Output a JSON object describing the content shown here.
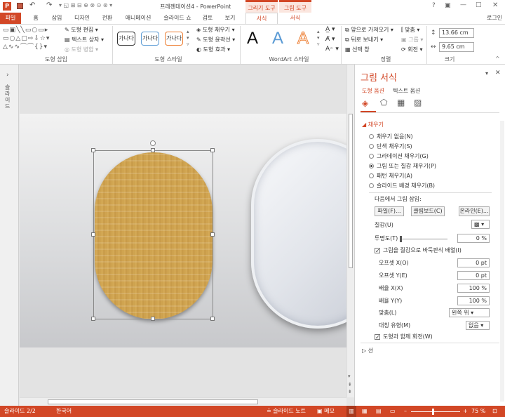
{
  "window": {
    "title": "프레젠테이션4 - PowerPoint",
    "contextual_drawing": "그리기 도구",
    "contextual_picture": "그림 도구",
    "signin": "로그인"
  },
  "tabs": [
    "파일",
    "홈",
    "삽입",
    "디자인",
    "전환",
    "애니메이션",
    "슬라이드 쇼",
    "검토",
    "보기",
    "서식",
    "서식"
  ],
  "ribbon": {
    "insert_shapes": {
      "label": "도형 삽입",
      "edit_shape": "도형 편집",
      "text_box": "텍스트 상자",
      "merge_shapes": "도형 병합"
    },
    "shape_styles": {
      "label": "도형 스타일",
      "sample": "가나다",
      "fill": "도형 채우기",
      "outline": "도형 윤곽선",
      "effects": "도형 효과"
    },
    "wordart": {
      "label": "WordArt 스타일",
      "sample": "A"
    },
    "arrange": {
      "label": "정렬",
      "bring_forward": "앞으로 가져오기",
      "send_backward": "뒤로 보내기",
      "selection_pane": "선택 창",
      "align": "맞춤",
      "group": "그룹",
      "rotate": "회전"
    },
    "size": {
      "label": "크기",
      "height": "13.66 cm",
      "width": "9.65 cm"
    }
  },
  "pane": {
    "title": "그림 서식",
    "tab_shape": "도형 옵션",
    "tab_text": "텍스트 옵션",
    "fill_section": "채우기",
    "fill_options": [
      "채우기 없음(N)",
      "단색 채우기(S)",
      "그라데이션 채우기(G)",
      "그림 또는 질감 채우기(P)",
      "패턴 채우기(A)",
      "슬라이드 배경 채우기(B)"
    ],
    "insert_from": "다음에서 그림 삽입:",
    "btn_file": "파일(F)...",
    "btn_clipboard": "클립보드(C)",
    "btn_online": "온라인(E)...",
    "texture": "질감(U)",
    "transparency": "투명도(T)",
    "transparency_val": "0 %",
    "tile": "그림을 질감으로 바둑판식 배열(I)",
    "offset_x": "오프셋 X(O)",
    "offset_x_val": "0 pt",
    "offset_y": "오프셋 Y(E)",
    "offset_y_val": "0 pt",
    "scale_x": "배율 X(X)",
    "scale_x_val": "100 %",
    "scale_y": "배율 Y(Y)",
    "scale_y_val": "100 %",
    "alignment": "맞춤(L)",
    "alignment_val": "왼쪽 위",
    "mirror": "대칭 유형(M)",
    "mirror_val": "없음",
    "rotate_with": "도형과 함께 회전(W)",
    "line_section": "선"
  },
  "leftstrip": {
    "label": "슬라이드"
  },
  "status": {
    "slide": "슬라이드 2/2",
    "language": "한국어",
    "notes": "슬라이드 노트",
    "comments": "메모",
    "zoom": "75 %"
  },
  "colors": {
    "accent": "#d24726",
    "contextual": "#d24726"
  }
}
